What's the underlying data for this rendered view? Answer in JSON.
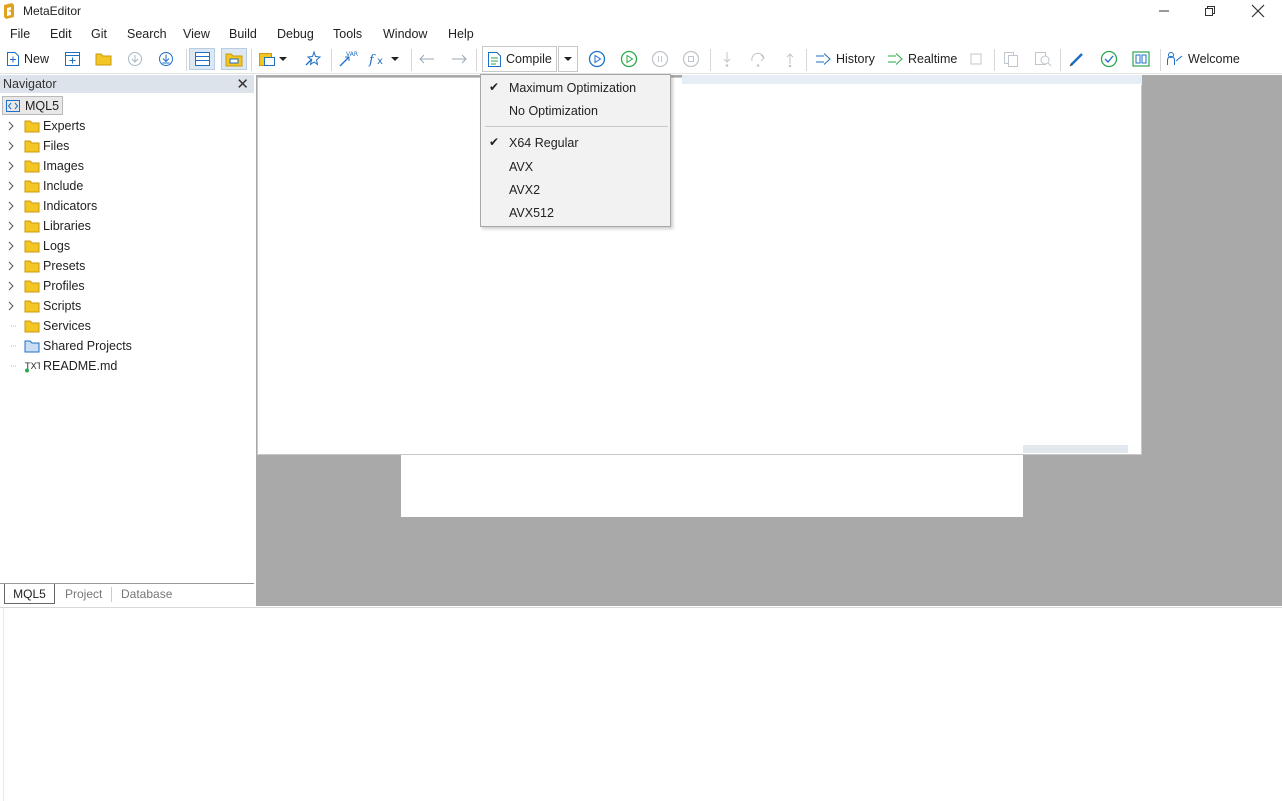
{
  "window": {
    "title": "MetaEditor"
  },
  "menu": [
    "File",
    "Edit",
    "Git",
    "Search",
    "View",
    "Build",
    "Debug",
    "Tools",
    "Window",
    "Help"
  ],
  "toolbar": {
    "new_label": "New",
    "compile_label": "Compile",
    "history_label": "History",
    "realtime_label": "Realtime",
    "welcome_label": "Welcome"
  },
  "navigator": {
    "title": "Navigator",
    "close": "✕",
    "root": "MQL5",
    "items": [
      {
        "label": "Experts",
        "type": "folder"
      },
      {
        "label": "Files",
        "type": "folder"
      },
      {
        "label": "Images",
        "type": "folder"
      },
      {
        "label": "Include",
        "type": "folder"
      },
      {
        "label": "Indicators",
        "type": "folder"
      },
      {
        "label": "Libraries",
        "type": "folder"
      },
      {
        "label": "Logs",
        "type": "folder"
      },
      {
        "label": "Presets",
        "type": "folder"
      },
      {
        "label": "Profiles",
        "type": "folder"
      },
      {
        "label": "Scripts",
        "type": "folder"
      },
      {
        "label": "Services",
        "type": "folder"
      },
      {
        "label": "Shared Projects",
        "type": "shared-folder"
      },
      {
        "label": "README.md",
        "type": "txt-file"
      }
    ],
    "tabs": [
      "MQL5",
      "Project",
      "Database"
    ]
  },
  "compile_menu": {
    "items": [
      {
        "label": "Maximum Optimization",
        "checked": true
      },
      {
        "label": "No Optimization",
        "checked": false
      },
      {
        "label": "X64 Regular",
        "checked": true
      },
      {
        "label": "AVX",
        "checked": false
      },
      {
        "label": "AVX2",
        "checked": false
      },
      {
        "label": "AVX512",
        "checked": false
      }
    ]
  },
  "colors": {
    "accent": "#1e6fc7",
    "folder": "#f3c623",
    "green": "#2aa84a",
    "nav_header": "#dde3ea",
    "editor_bg": "#a9a9a9"
  }
}
